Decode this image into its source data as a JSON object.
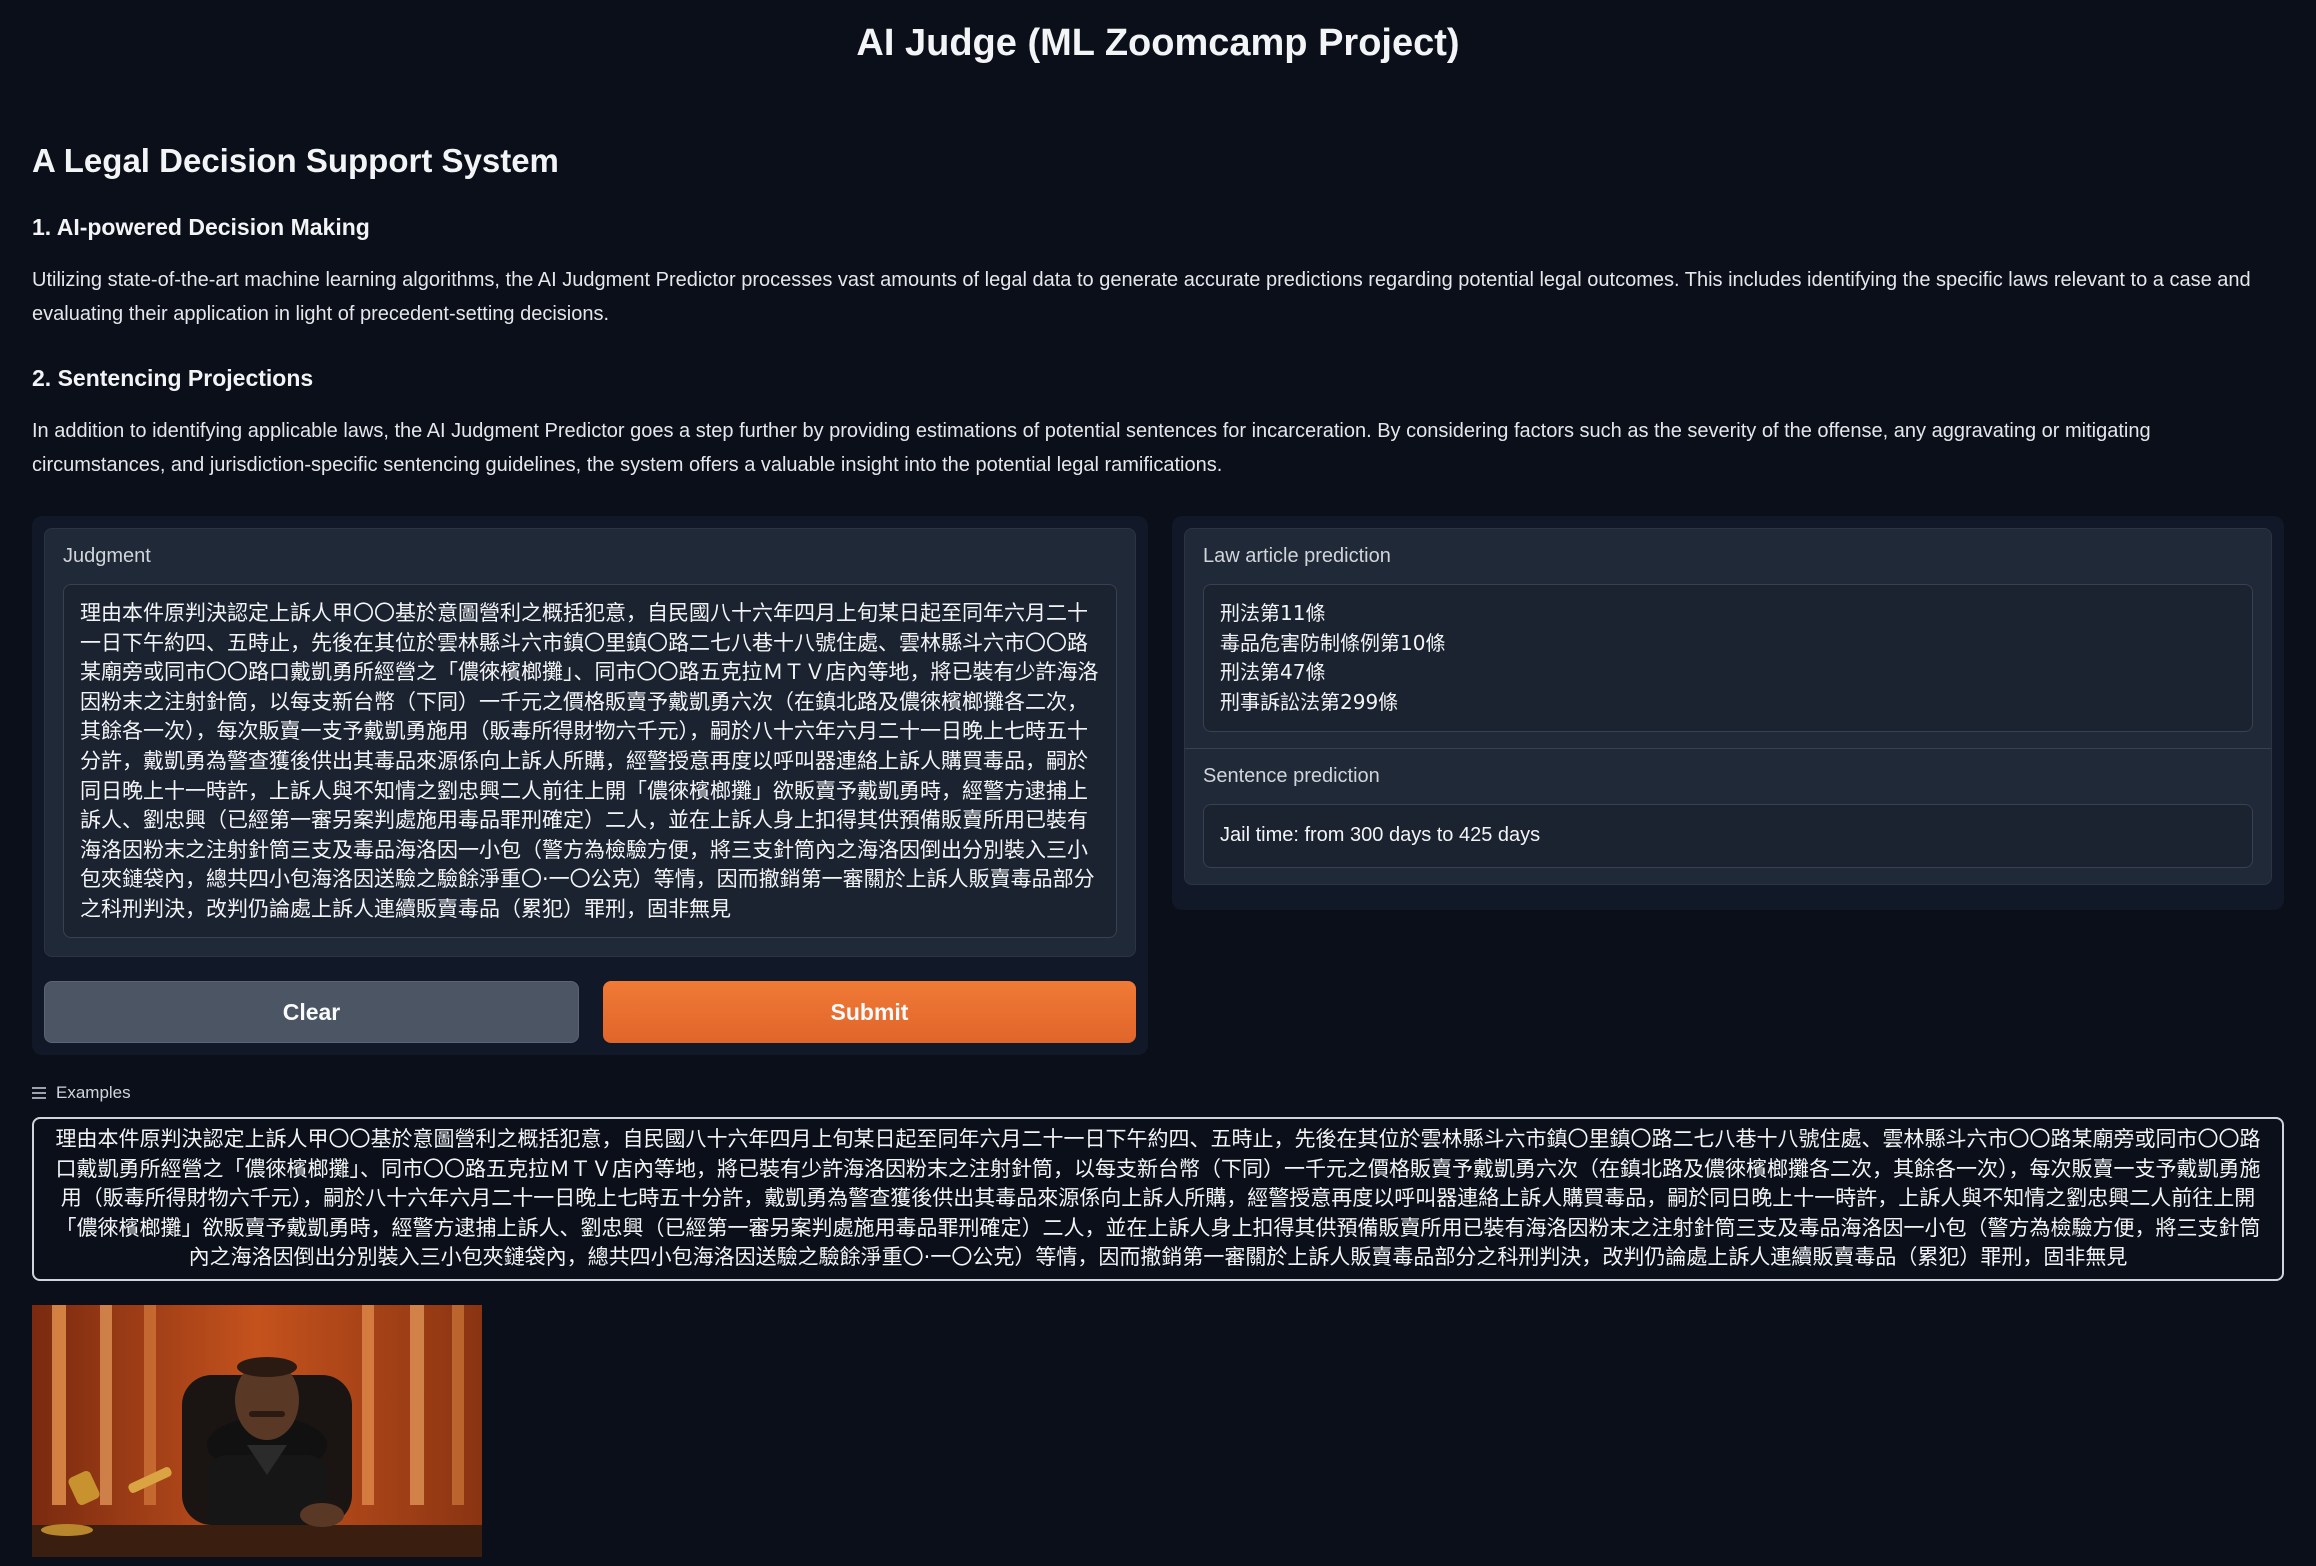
{
  "app": {
    "title": "AI Judge (ML Zoomcamp Project)"
  },
  "intro": {
    "subtitle": "A Legal Decision Support System",
    "section1_heading": "1. AI-powered Decision Making",
    "section1_text": "Utilizing state-of-the-art machine learning algorithms, the AI Judgment Predictor processes vast amounts of legal data to generate accurate predictions regarding potential legal outcomes. This includes identifying the specific laws relevant to a case and evaluating their application in light of precedent-setting decisions.",
    "section2_heading": "2. Sentencing Projections",
    "section2_text": "In addition to identifying applicable laws, the AI Judgment Predictor goes a step further by providing estimations of potential sentences for incarceration. By considering factors such as the severity of the offense, any aggravating or mitigating circumstances, and jurisdiction-specific sentencing guidelines, the system offers a valuable insight into the potential legal ramifications."
  },
  "judgment": {
    "label": "Judgment",
    "value": "理由本件原判決認定上訴人甲〇〇基於意圖營利之概括犯意，自民國八十六年四月上旬某日起至同年六月二十一日下午約四、五時止，先後在其位於雲林縣斗六市鎮〇里鎮〇路二七八巷十八號住處、雲林縣斗六市〇〇路某廟旁或同市〇〇路口戴凱勇所經營之「儂徠檳榔攤」、同市〇〇路五克拉ＭＴＶ店內等地，將已裝有少許海洛因粉末之注射針筒，以每支新台幣（下同）一千元之價格販賣予戴凱勇六次（在鎮北路及儂徠檳榔攤各二次，其餘各一次），每次販賣一支予戴凱勇施用（販毒所得財物六千元），嗣於八十六年六月二十一日晚上七時五十分許，戴凱勇為警查獲後供出其毒品來源係向上訴人所購，經警授意再度以呼叫器連絡上訴人購買毒品，嗣於同日晚上十一時許，上訴人與不知情之劉忠興二人前往上開「儂徠檳榔攤」欲販賣予戴凱勇時，經警方逮捕上訴人、劉忠興（已經第一審另案判處施用毒品罪刑確定）二人，並在上訴人身上扣得其供預備販賣所用已裝有海洛因粉末之注射針筒三支及毒品海洛因一小包（警方為檢驗方便，將三支針筒內之海洛因倒出分別裝入三小包夾鏈袋內，總共四小包海洛因送驗之驗餘淨重〇·一〇公克）等情，因而撤銷第一審關於上訴人販賣毒品部分之科刑判決，改判仍論處上訴人連續販賣毒品（累犯）罪刑，固非無見"
  },
  "buttons": {
    "clear": "Clear",
    "submit": "Submit"
  },
  "law_prediction": {
    "label": "Law article prediction",
    "lines": [
      "刑法第11條",
      "毒品危害防制條例第10條",
      "刑法第47條",
      "刑事訴訟法第299條"
    ]
  },
  "sentence_prediction": {
    "label": "Sentence prediction",
    "value": "Jail time: from 300 days to 425 days"
  },
  "examples": {
    "label": "Examples",
    "items": [
      "理由本件原判決認定上訴人甲〇〇基於意圖營利之概括犯意，自民國八十六年四月上旬某日起至同年六月二十一日下午約四、五時止，先後在其位於雲林縣斗六市鎮〇里鎮〇路二七八巷十八號住處、雲林縣斗六市〇〇路某廟旁或同市〇〇路口戴凱勇所經營之「儂徠檳榔攤」、同市〇〇路五克拉ＭＴＶ店內等地，將已裝有少許海洛因粉末之注射針筒，以每支新台幣（下同）一千元之價格販賣予戴凱勇六次（在鎮北路及儂徠檳榔攤各二次，其餘各一次），每次販賣一支予戴凱勇施用（販毒所得財物六千元），嗣於八十六年六月二十一日晚上七時五十分許，戴凱勇為警查獲後供出其毒品來源係向上訴人所購，經警授意再度以呼叫器連絡上訴人購買毒品，嗣於同日晚上十一時許，上訴人與不知情之劉忠興二人前往上開「儂徠檳榔攤」欲販賣予戴凱勇時，經警方逮捕上訴人、劉忠興（已經第一審另案判處施用毒品罪刑確定）二人，並在上訴人身上扣得其供預備販賣所用已裝有海洛因粉末之注射針筒三支及毒品海洛因一小包（警方為檢驗方便，將三支針筒內之海洛因倒出分別裝入三小包夾鏈袋內，總共四小包海洛因送驗之驗餘淨重〇·一〇公克）等情，因而撤銷第一審關於上訴人販賣毒品部分之科刑判決，改判仍論處上訴人連續販賣毒品（累犯）罪刑，固非無見"
    ]
  },
  "image": {
    "subject": "judge-with-gavel"
  }
}
